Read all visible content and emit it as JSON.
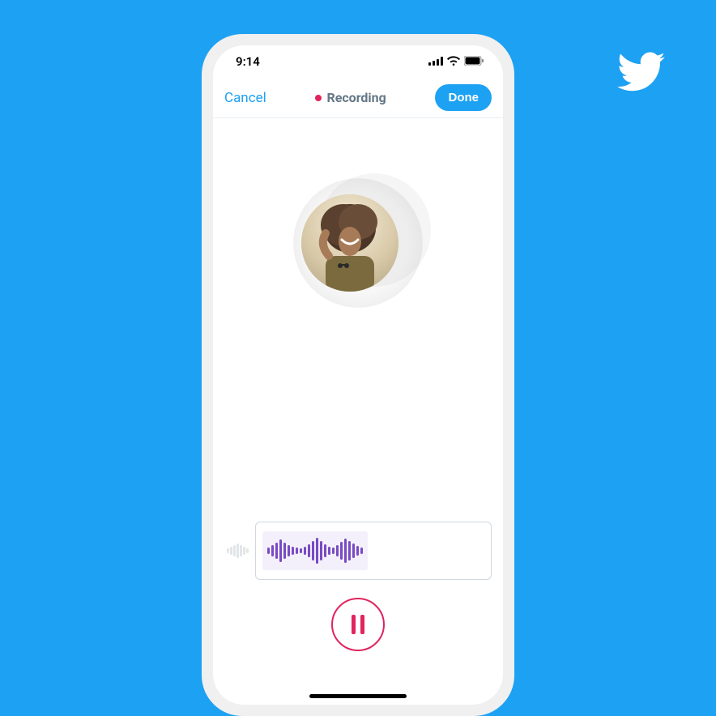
{
  "status": {
    "time": "9:14"
  },
  "nav": {
    "cancel": "Cancel",
    "status": "Recording",
    "done": "Done"
  },
  "icons": {
    "twitter": "twitter-bird-icon",
    "signal": "cellular-signal-icon",
    "wifi": "wifi-icon",
    "battery": "battery-full-icon",
    "recDot": "record-dot-icon",
    "pause": "pause-icon",
    "avatar": "user-avatar"
  },
  "colors": {
    "brand": "#1DA1F2",
    "record": "#E0245E",
    "waveform": "#794bc4"
  },
  "waveform": {
    "prev_bars": [
      6,
      10,
      14,
      18,
      14,
      10,
      6
    ],
    "current_bars": [
      8,
      14,
      20,
      28,
      20,
      14,
      10,
      8,
      6,
      10,
      16,
      24,
      32,
      24,
      16,
      10,
      8,
      14,
      22,
      30,
      24,
      18,
      12,
      8
    ]
  }
}
